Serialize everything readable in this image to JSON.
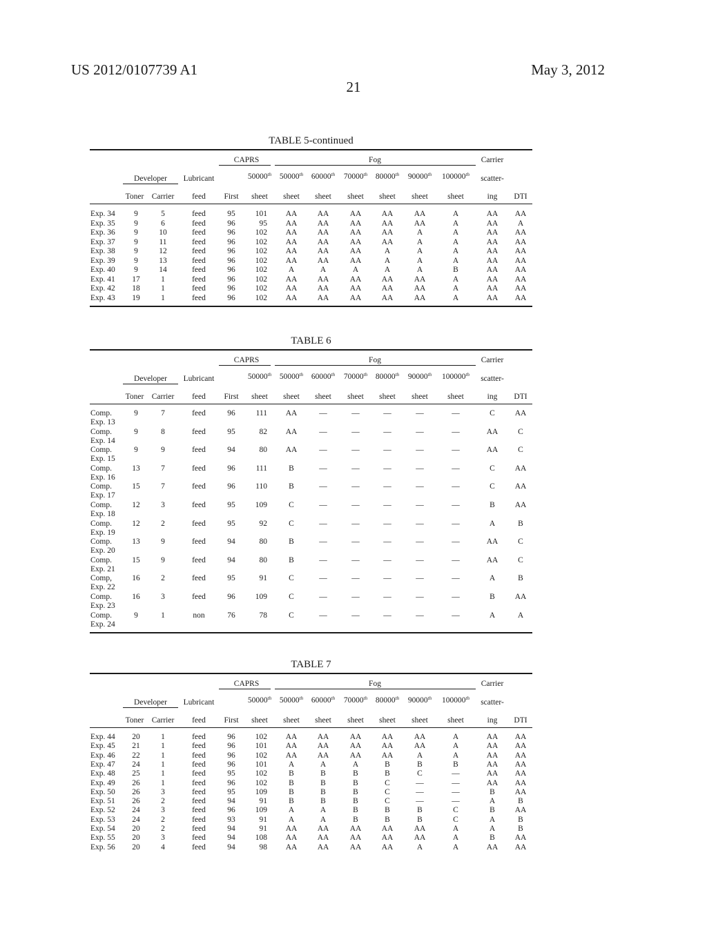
{
  "header": {
    "doc_id": "US 2012/0107739 A1",
    "date": "May 3, 2012",
    "page": "21"
  },
  "column_headers": {
    "group_developer": "Developer",
    "group_caprs": "CAPRS",
    "group_fog": "Fog",
    "carrier": "Carrier",
    "lubricant": "Lubricant",
    "caprs_50000": "50000",
    "fog_50000": "50000",
    "fog_60000": "60000",
    "fog_70000": "70000",
    "fog_80000": "80000",
    "fog_90000": "90000",
    "fog_100000": "100000",
    "th": "th",
    "scattering_1": "scatter-",
    "toner": "Toner",
    "carrier_col": "Carrier",
    "feed": "feed",
    "first": "First",
    "sheet": "sheet",
    "scattering_2": "ing",
    "dti": "DTI"
  },
  "tables": [
    {
      "title": "TABLE 5-continued",
      "rows": [
        {
          "label": [
            "Exp. 34"
          ],
          "toner": "9",
          "carrier": "5",
          "lub": "feed",
          "first": "95",
          "caprs": "101",
          "fog": [
            "AA",
            "AA",
            "AA",
            "AA",
            "AA",
            "A"
          ],
          "scatter": "AA",
          "dti": "AA"
        },
        {
          "label": [
            "Exp. 35"
          ],
          "toner": "9",
          "carrier": "6",
          "lub": "feed",
          "first": "96",
          "caprs": "95",
          "fog": [
            "AA",
            "AA",
            "AA",
            "AA",
            "AA",
            "A"
          ],
          "scatter": "AA",
          "dti": "A"
        },
        {
          "label": [
            "Exp. 36"
          ],
          "toner": "9",
          "carrier": "10",
          "lub": "feed",
          "first": "96",
          "caprs": "102",
          "fog": [
            "AA",
            "AA",
            "AA",
            "AA",
            "A",
            "A"
          ],
          "scatter": "AA",
          "dti": "AA"
        },
        {
          "label": [
            "Exp. 37"
          ],
          "toner": "9",
          "carrier": "11",
          "lub": "feed",
          "first": "96",
          "caprs": "102",
          "fog": [
            "AA",
            "AA",
            "AA",
            "AA",
            "A",
            "A"
          ],
          "scatter": "AA",
          "dti": "AA"
        },
        {
          "label": [
            "Exp. 38"
          ],
          "toner": "9",
          "carrier": "12",
          "lub": "feed",
          "first": "96",
          "caprs": "102",
          "fog": [
            "AA",
            "AA",
            "AA",
            "A",
            "A",
            "A"
          ],
          "scatter": "AA",
          "dti": "AA"
        },
        {
          "label": [
            "Exp. 39"
          ],
          "toner": "9",
          "carrier": "13",
          "lub": "feed",
          "first": "96",
          "caprs": "102",
          "fog": [
            "AA",
            "AA",
            "AA",
            "A",
            "A",
            "A"
          ],
          "scatter": "AA",
          "dti": "AA"
        },
        {
          "label": [
            "Exp. 40"
          ],
          "toner": "9",
          "carrier": "14",
          "lub": "feed",
          "first": "96",
          "caprs": "102",
          "fog": [
            "A",
            "A",
            "A",
            "A",
            "A",
            "B"
          ],
          "scatter": "AA",
          "dti": "AA"
        },
        {
          "label": [
            "Exp. 41"
          ],
          "toner": "17",
          "carrier": "1",
          "lub": "feed",
          "first": "96",
          "caprs": "102",
          "fog": [
            "AA",
            "AA",
            "AA",
            "AA",
            "AA",
            "A"
          ],
          "scatter": "AA",
          "dti": "AA"
        },
        {
          "label": [
            "Exp. 42"
          ],
          "toner": "18",
          "carrier": "1",
          "lub": "feed",
          "first": "96",
          "caprs": "102",
          "fog": [
            "AA",
            "AA",
            "AA",
            "AA",
            "AA",
            "A"
          ],
          "scatter": "AA",
          "dti": "AA"
        },
        {
          "label": [
            "Exp. 43"
          ],
          "toner": "19",
          "carrier": "1",
          "lub": "feed",
          "first": "96",
          "caprs": "102",
          "fog": [
            "AA",
            "AA",
            "AA",
            "AA",
            "AA",
            "A"
          ],
          "scatter": "AA",
          "dti": "AA"
        }
      ]
    },
    {
      "title": "TABLE 6",
      "rows": [
        {
          "label": [
            "Comp.",
            "Exp. 13"
          ],
          "toner": "9",
          "carrier": "7",
          "lub": "feed",
          "first": "96",
          "caprs": "111",
          "fog": [
            "AA",
            "—",
            "—",
            "—",
            "—",
            "—"
          ],
          "scatter": "C",
          "dti": "AA"
        },
        {
          "label": [
            "Comp.",
            "Exp. 14"
          ],
          "toner": "9",
          "carrier": "8",
          "lub": "feed",
          "first": "95",
          "caprs": "82",
          "fog": [
            "AA",
            "—",
            "—",
            "—",
            "—",
            "—"
          ],
          "scatter": "AA",
          "dti": "C"
        },
        {
          "label": [
            "Comp.",
            "Exp. 15"
          ],
          "toner": "9",
          "carrier": "9",
          "lub": "feed",
          "first": "94",
          "caprs": "80",
          "fog": [
            "AA",
            "—",
            "—",
            "—",
            "—",
            "—"
          ],
          "scatter": "AA",
          "dti": "C"
        },
        {
          "label": [
            "Comp.",
            "Exp. 16"
          ],
          "toner": "13",
          "carrier": "7",
          "lub": "feed",
          "first": "96",
          "caprs": "111",
          "fog": [
            "B",
            "—",
            "—",
            "—",
            "—",
            "—"
          ],
          "scatter": "C",
          "dti": "AA"
        },
        {
          "label": [
            "Comp.",
            "Exp. 17"
          ],
          "toner": "15",
          "carrier": "7",
          "lub": "feed",
          "first": "96",
          "caprs": "110",
          "fog": [
            "B",
            "—",
            "—",
            "—",
            "—",
            "—"
          ],
          "scatter": "C",
          "dti": "AA"
        },
        {
          "label": [
            "Comp.",
            "Exp. 18"
          ],
          "toner": "12",
          "carrier": "3",
          "lub": "feed",
          "first": "95",
          "caprs": "109",
          "fog": [
            "C",
            "—",
            "—",
            "—",
            "—",
            "—"
          ],
          "scatter": "B",
          "dti": "AA"
        },
        {
          "label": [
            "Comp.",
            "Exp. 19"
          ],
          "toner": "12",
          "carrier": "2",
          "lub": "feed",
          "first": "95",
          "caprs": "92",
          "fog": [
            "C",
            "—",
            "—",
            "—",
            "—",
            "—"
          ],
          "scatter": "A",
          "dti": "B"
        },
        {
          "label": [
            "Comp.",
            "Exp. 20"
          ],
          "toner": "13",
          "carrier": "9",
          "lub": "feed",
          "first": "94",
          "caprs": "80",
          "fog": [
            "B",
            "—",
            "—",
            "—",
            "—",
            "—"
          ],
          "scatter": "AA",
          "dti": "C"
        },
        {
          "label": [
            "Comp.",
            "Exp. 21"
          ],
          "toner": "15",
          "carrier": "9",
          "lub": "feed",
          "first": "94",
          "caprs": "80",
          "fog": [
            "B",
            "—",
            "—",
            "—",
            "—",
            "—"
          ],
          "scatter": "AA",
          "dti": "C"
        },
        {
          "label": [
            "Comp,",
            "Exp. 22"
          ],
          "toner": "16",
          "carrier": "2",
          "lub": "feed",
          "first": "95",
          "caprs": "91",
          "fog": [
            "C",
            "—",
            "—",
            "—",
            "—",
            "—"
          ],
          "scatter": "A",
          "dti": "B"
        },
        {
          "label": [
            "Comp.",
            "Exp. 23"
          ],
          "toner": "16",
          "carrier": "3",
          "lub": "feed",
          "first": "96",
          "caprs": "109",
          "fog": [
            "C",
            "—",
            "—",
            "—",
            "—",
            "—"
          ],
          "scatter": "B",
          "dti": "AA"
        },
        {
          "label": [
            "Comp.",
            "Exp. 24"
          ],
          "toner": "9",
          "carrier": "1",
          "lub": "non",
          "first": "76",
          "caprs": "78",
          "fog": [
            "C",
            "—",
            "—",
            "—",
            "—",
            "—"
          ],
          "scatter": "A",
          "dti": "A"
        }
      ]
    },
    {
      "title": "TABLE 7",
      "rows": [
        {
          "label": [
            "Exp. 44"
          ],
          "toner": "20",
          "carrier": "1",
          "lub": "feed",
          "first": "96",
          "caprs": "102",
          "fog": [
            "AA",
            "AA",
            "AA",
            "AA",
            "AA",
            "A"
          ],
          "scatter": "AA",
          "dti": "AA"
        },
        {
          "label": [
            "Exp. 45"
          ],
          "toner": "21",
          "carrier": "1",
          "lub": "feed",
          "first": "96",
          "caprs": "101",
          "fog": [
            "AA",
            "AA",
            "AA",
            "AA",
            "AA",
            "A"
          ],
          "scatter": "AA",
          "dti": "AA"
        },
        {
          "label": [
            "Exp. 46"
          ],
          "toner": "22",
          "carrier": "1",
          "lub": "feed",
          "first": "96",
          "caprs": "102",
          "fog": [
            "AA",
            "AA",
            "AA",
            "AA",
            "A",
            "A"
          ],
          "scatter": "AA",
          "dti": "AA"
        },
        {
          "label": [
            "Exp. 47"
          ],
          "toner": "24",
          "carrier": "1",
          "lub": "feed",
          "first": "96",
          "caprs": "101",
          "fog": [
            "A",
            "A",
            "A",
            "B",
            "B",
            "B"
          ],
          "scatter": "AA",
          "dti": "AA"
        },
        {
          "label": [
            "Exp. 48"
          ],
          "toner": "25",
          "carrier": "1",
          "lub": "feed",
          "first": "95",
          "caprs": "102",
          "fog": [
            "B",
            "B",
            "B",
            "B",
            "C",
            "—"
          ],
          "scatter": "AA",
          "dti": "AA"
        },
        {
          "label": [
            "Exp. 49"
          ],
          "toner": "26",
          "carrier": "1",
          "lub": "feed",
          "first": "96",
          "caprs": "102",
          "fog": [
            "B",
            "B",
            "B",
            "C",
            "—",
            "—"
          ],
          "scatter": "AA",
          "dti": "AA"
        },
        {
          "label": [
            "Exp. 50"
          ],
          "toner": "26",
          "carrier": "3",
          "lub": "feed",
          "first": "95",
          "caprs": "109",
          "fog": [
            "B",
            "B",
            "B",
            "C",
            "—",
            "—"
          ],
          "scatter": "B",
          "dti": "AA"
        },
        {
          "label": [
            "Exp. 51"
          ],
          "toner": "26",
          "carrier": "2",
          "lub": "feed",
          "first": "94",
          "caprs": "91",
          "fog": [
            "B",
            "B",
            "B",
            "C",
            "—",
            "—"
          ],
          "scatter": "A",
          "dti": "B"
        },
        {
          "label": [
            "Exp. 52"
          ],
          "toner": "24",
          "carrier": "3",
          "lub": "feed",
          "first": "96",
          "caprs": "109",
          "fog": [
            "A",
            "A",
            "B",
            "B",
            "B",
            "C"
          ],
          "scatter": "B",
          "dti": "AA"
        },
        {
          "label": [
            "Exp. 53"
          ],
          "toner": "24",
          "carrier": "2",
          "lub": "feed",
          "first": "93",
          "caprs": "91",
          "fog": [
            "A",
            "A",
            "B",
            "B",
            "B",
            "C"
          ],
          "scatter": "A",
          "dti": "B"
        },
        {
          "label": [
            "Exp. 54"
          ],
          "toner": "20",
          "carrier": "2",
          "lub": "feed",
          "first": "94",
          "caprs": "91",
          "fog": [
            "AA",
            "AA",
            "AA",
            "AA",
            "AA",
            "A"
          ],
          "scatter": "A",
          "dti": "B"
        },
        {
          "label": [
            "Exp. 55"
          ],
          "toner": "20",
          "carrier": "3",
          "lub": "feed",
          "first": "94",
          "caprs": "108",
          "fog": [
            "AA",
            "AA",
            "AA",
            "AA",
            "AA",
            "A"
          ],
          "scatter": "B",
          "dti": "AA"
        },
        {
          "label": [
            "Exp. 56"
          ],
          "toner": "20",
          "carrier": "4",
          "lub": "feed",
          "first": "94",
          "caprs": "98",
          "fog": [
            "AA",
            "AA",
            "AA",
            "AA",
            "A",
            "A"
          ],
          "scatter": "AA",
          "dti": "AA"
        }
      ]
    }
  ]
}
